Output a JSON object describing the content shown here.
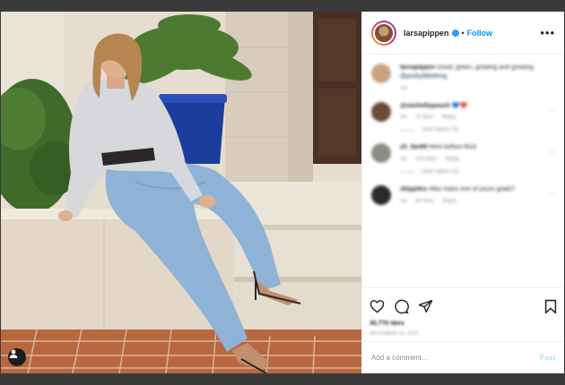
{
  "post": {
    "username": "larsapippen",
    "follow_label": "Follow",
    "separator": "•",
    "more_label": "•••"
  },
  "caption": {
    "username": "larsapippen",
    "text": "Good, green, growing and growing",
    "mention": "@prettylittlething",
    "time": "1w"
  },
  "comments": [
    {
      "username": "@michellepooch",
      "text": "💙❤️",
      "time": "1w",
      "likes": "11 likes",
      "reply": "Reply",
      "replies": "View replies (3)"
    },
    {
      "username": "ch_fan99",
      "text": "Here before thick",
      "time": "1w",
      "likes": "104 likes",
      "reply": "Reply",
      "replies": "View replies (2)"
    },
    {
      "username": "skippites",
      "text": "Was mans one of yours goals?",
      "time": "1w",
      "likes": "80 likes",
      "reply": "Reply",
      "replies": ""
    }
  ],
  "actions": {
    "likes": "30,770 likes",
    "date": "DECEMBER 18, 2020"
  },
  "add_comment": {
    "placeholder": "Add a comment…",
    "post_label": "Post"
  },
  "colors": {
    "accent": "#0095f6",
    "post_disabled": "#b2dffc",
    "backdrop": "#3a3a3a"
  },
  "icons": [
    "heart-icon",
    "comment-icon",
    "share-icon",
    "bookmark-icon",
    "user-tag-icon",
    "verified-badge-icon"
  ]
}
